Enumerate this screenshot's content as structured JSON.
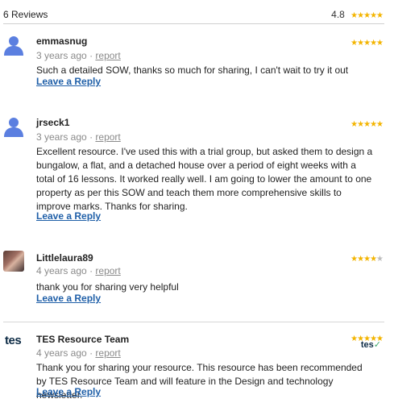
{
  "header": {
    "count": "6 Reviews",
    "average": "4.8",
    "stars": "★★★★★"
  },
  "reviews": [
    {
      "name": "emmasnug",
      "time": "3 years ago",
      "separator": "·",
      "report": "report",
      "text": "Such a detailed SOW, thanks so much for sharing, I can't wait to try it out",
      "reply": "Leave a Reply",
      "stars_full": "★★★★★",
      "stars_empty": ""
    },
    {
      "name": "jrseck1",
      "time": "3 years ago",
      "separator": "·",
      "report": "report",
      "text": "Excellent resource. I've used this with a trial group, but asked them to design a bungalow, a flat, and a detached house over a period of eight weeks with a total of 16 lessons. It worked really well. I am going to lower the amount to one property as per this SOW and teach them more comprehensive skills to improve marks. Thanks for sharing.",
      "reply": "Leave a Reply",
      "stars_full": "★★★★★",
      "stars_empty": ""
    },
    {
      "name": "Littlelaura89",
      "time": "4 years ago",
      "separator": "·",
      "report": "report",
      "text": "thank you for sharing very helpful",
      "reply": "Leave a Reply",
      "stars_full": "★★★★",
      "stars_empty": "★"
    },
    {
      "name": "TES Resource Team",
      "time": "4 years ago",
      "separator": "·",
      "report": "report",
      "text": "Thank you for sharing your resource. This resource has been recommended by TES Resource Team and will feature in the Design and technology newsletter.",
      "reply": "Leave a Reply",
      "stars_full": "★★★★★",
      "stars_empty": "",
      "logo": "tes",
      "badge": "tes"
    }
  ]
}
